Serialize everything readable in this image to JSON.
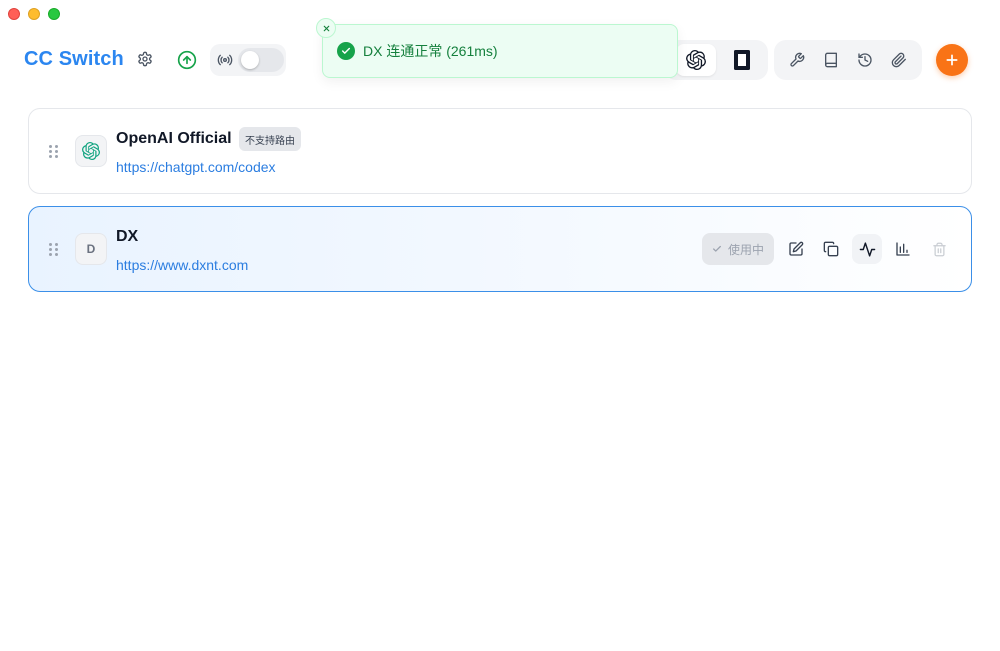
{
  "app": {
    "title": "CC Switch"
  },
  "header": {
    "settings_icon": "gear-icon",
    "update_icon": "arrow-up-circle-icon",
    "proxy_icon": "broadcast-icon",
    "proxy_enabled": false,
    "apps": [
      {
        "id": "codex",
        "icon": "openai-icon",
        "selected": true
      },
      {
        "id": "terminal",
        "icon": "terminal-icon",
        "selected": false
      }
    ],
    "tools": [
      "wrench-icon",
      "book-icon",
      "history-icon",
      "paperclip-icon"
    ],
    "add_icon": "plus-icon"
  },
  "toast": {
    "text": "DX 连通正常 (261ms)",
    "type": "success"
  },
  "providers": [
    {
      "name": "OpenAI Official",
      "url": "https://chatgpt.com/codex",
      "badge": "不支持路由",
      "icon": "openai-icon",
      "active": false
    },
    {
      "name": "DX",
      "url": "https://www.dxnt.com",
      "icon_letter": "D",
      "active": true,
      "status_label": "使用中",
      "actions": [
        "edit-icon",
        "copy-icon",
        "activity-icon",
        "bar-chart-icon",
        "trash-icon"
      ]
    }
  ],
  "colors": {
    "brand": "#2b86f0",
    "accent": "#f97316",
    "success": "#16a34a",
    "active_border": "#3b8fe8",
    "openai": "#10a37f"
  }
}
